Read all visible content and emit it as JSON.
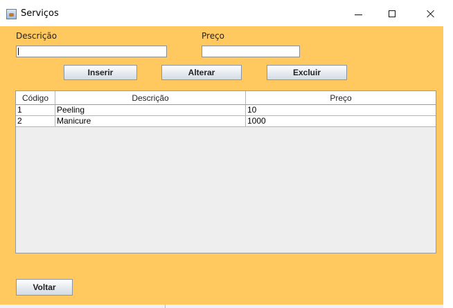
{
  "window": {
    "title": "Serviços",
    "icon": "java-app-icon"
  },
  "form": {
    "descricao": {
      "label": "Descrição",
      "value": ""
    },
    "preco": {
      "label": "Preço",
      "value": ""
    }
  },
  "buttons": {
    "inserir": "Inserir",
    "alterar": "Alterar",
    "excluir": "Excluir",
    "voltar": "Voltar"
  },
  "table": {
    "headers": [
      "Código",
      "Descrição",
      "Preço"
    ],
    "rows": [
      [
        "1",
        "Peeling",
        "10"
      ],
      [
        "2",
        "Manicure",
        "1000"
      ]
    ]
  },
  "colors": {
    "background": "#ffc95f",
    "table_area": "#eeeeee"
  }
}
